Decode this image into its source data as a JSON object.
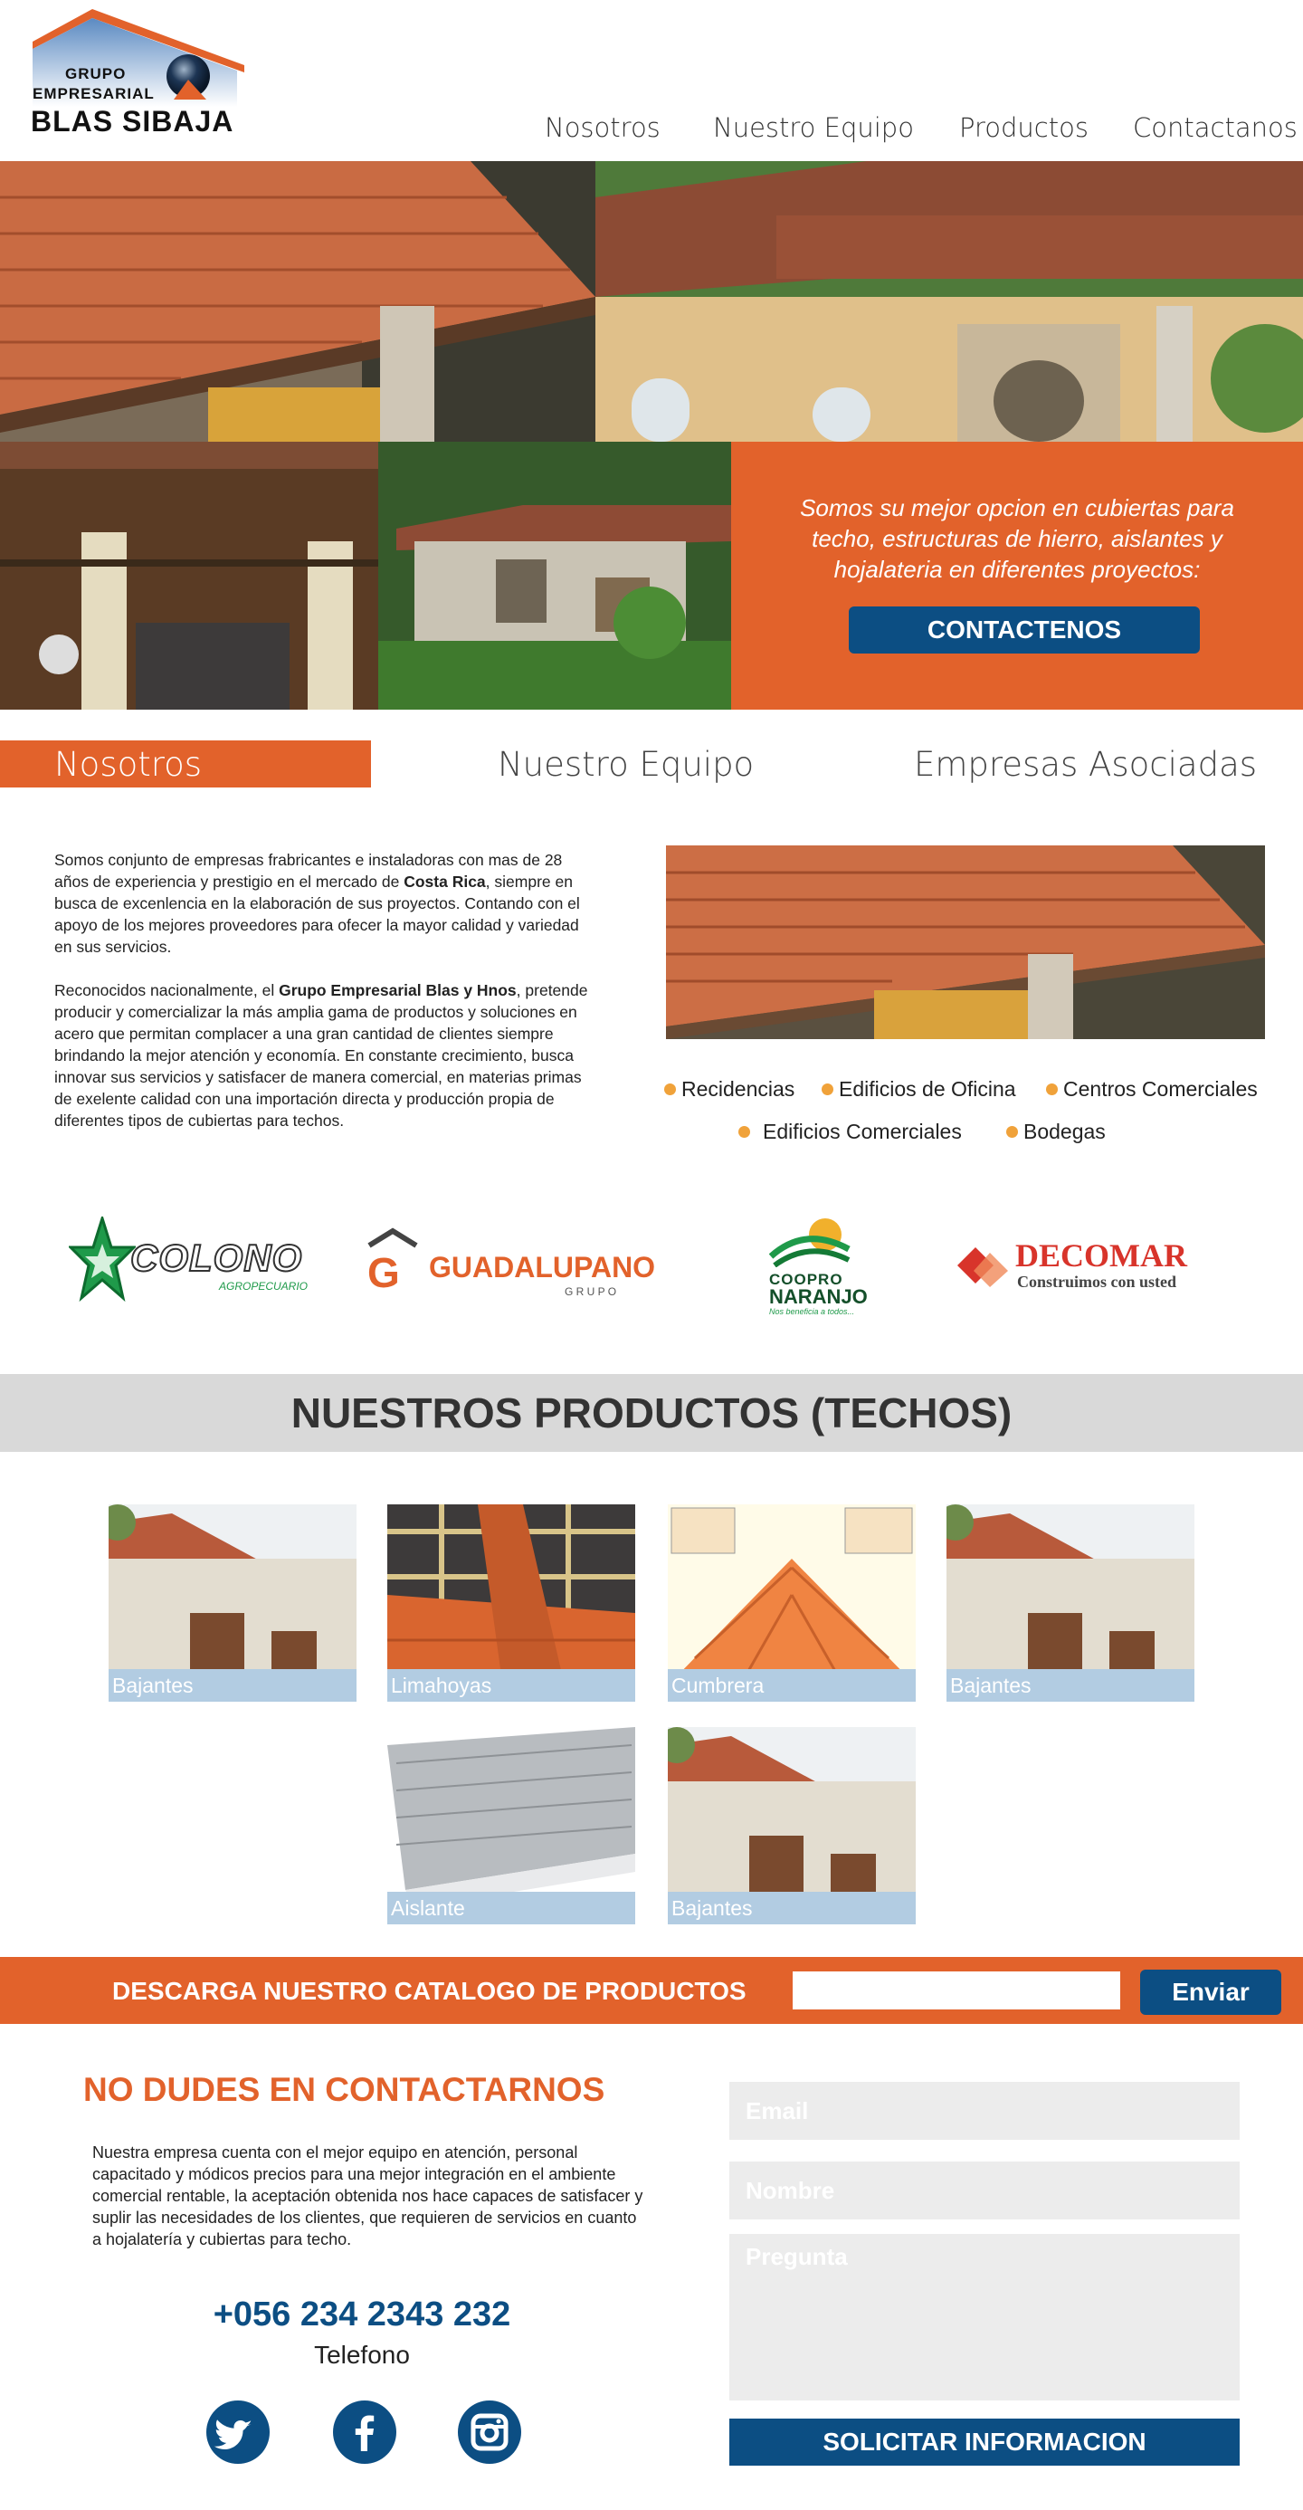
{
  "brand": {
    "line1": "GRUPO",
    "line2": "EMPRESARIAL",
    "line3": "BLAS SIBAJA"
  },
  "nav": {
    "items": [
      "Nosotros",
      "Nuestro Equipo",
      "Productos",
      "Contactanos"
    ]
  },
  "hero": {
    "text": "Somos su mejor opcion  en cubiertas para techo, estructuras de hierro, aislantes y hojalateria en diferentes proyectos:",
    "button": "CONTACTENOS"
  },
  "tabs": [
    "Nosotros",
    "Nuestro Equipo",
    "Empresas Asociadas"
  ],
  "about": {
    "p1_a": "Somos conjunto de empresas frabricantes e instaladoras con mas de 28 años de experiencia  y prestigio en el mercado de ",
    "p1_bold": "Costa Rica",
    "p1_b": ", siempre en busca de excenlencia en la elaboración de sus proyectos. Contando con el apoyo de los mejores proveedores para ofecer la mayor calidad y variedad en sus servicios.",
    "p2_a": "Reconocidos nacionalmente, el ",
    "p2_bold": "Grupo Empresarial Blas y Hnos",
    "p2_b": ", pretende producir y comercializar la más amplia gama de productos y soluciones en acero que permitan complacer a una gran cantidad de clientes siempre brindando la mejor atención y economía. En constante crecimiento, busca innovar sus servicios y satisfacer de manera comercial, en materias primas de exelente calidad con una importación directa y producción propia de diferentes tipos de cubiertas para techos.",
    "bullets": [
      "Recidencias",
      "Edificios de Oficina",
      "Centros Comerciales",
      "Edificios Comerciales",
      "Bodegas"
    ]
  },
  "partners": {
    "colono": "COLONO",
    "colono_sub": "AGROPECUARIO",
    "guadalupano": "GUADALUPANO",
    "guadalupano_sub": "G R U P O",
    "coopro1": "COOPRO",
    "coopro2": "NARANJO",
    "coopro_sub": "Nos beneficia a todos...",
    "decomar": "DECOMAR",
    "decomar_sub": "Construimos con usted"
  },
  "products": {
    "title": "NUESTROS PRODUCTOS (TECHOS)",
    "items": [
      "Bajantes",
      "Limahoyas",
      "Cumbrera",
      "Bajantes",
      "Aislante",
      "Bajantes"
    ]
  },
  "catalog": {
    "label": "DESCARGA NUESTRO CATALOGO DE PRODUCTOS",
    "input_value": "",
    "button": "Enviar"
  },
  "contact": {
    "title": "NO DUDES EN CONTACTARNOS",
    "text": "Nuestra empresa cuenta con el mejor equipo en atención, personal capacitado y  módicos precios para una mejor integración en el ambiente comercial rentable, la aceptación obtenida nos hace capaces de satisfacer y suplir las necesidades de los clientes, que requieren de servicios en cuanto a hojalatería y cubiertas para techo.",
    "phone": "+056 234 2343 232",
    "phone_label": "Telefono",
    "email_ph": "Email",
    "name_ph": "Nombre",
    "question_ph": "Pregunta",
    "submit": "SOLICITAR INFORMACION"
  },
  "colors": {
    "orange": "#e2622b",
    "navy": "#0c4e83",
    "gray_band": "#d9d9d9",
    "label_blue": "#b2cce2"
  }
}
